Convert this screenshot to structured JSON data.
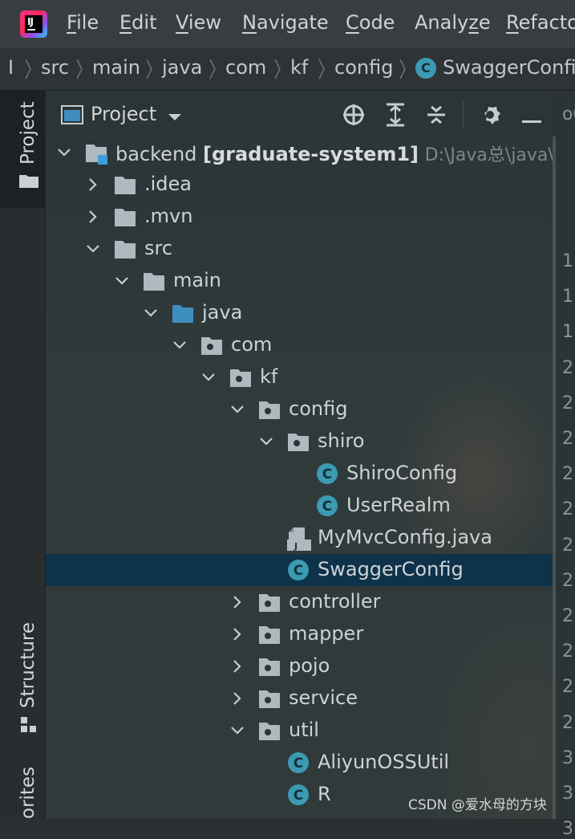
{
  "menu": {
    "items": [
      {
        "mnemonic": "F",
        "rest": "ile"
      },
      {
        "mnemonic": "E",
        "rest": "dit"
      },
      {
        "mnemonic": "V",
        "rest": "iew"
      },
      {
        "mnemonic": "N",
        "rest": "avigate"
      },
      {
        "mnemonic": "C",
        "rest": "ode"
      },
      {
        "prefix": "Analy",
        "mnemonic": "z",
        "rest": "e"
      },
      {
        "mnemonic": "R",
        "rest": "efacto"
      }
    ]
  },
  "breadcrumb": {
    "items": [
      "src",
      "main",
      "java",
      "com",
      "kf",
      "config"
    ],
    "current": "SwaggerConfig",
    "current_badge": "C"
  },
  "tool_strip": {
    "project_label": "Project",
    "structure_label": "Structure",
    "favorites_label": "orites"
  },
  "project_panel": {
    "title": "Project",
    "tree": [
      {
        "label": "backend",
        "bold": "[graduate-system1]",
        "path": "D:\\Java总\\java\\项",
        "depth": 0,
        "expanded": true,
        "icon": "module-folder-icon"
      },
      {
        "label": ".idea",
        "depth": 1,
        "expanded": false,
        "icon": "folder-icon"
      },
      {
        "label": ".mvn",
        "depth": 1,
        "expanded": false,
        "icon": "folder-icon"
      },
      {
        "label": "src",
        "depth": 1,
        "expanded": true,
        "icon": "folder-icon"
      },
      {
        "label": "main",
        "depth": 2,
        "expanded": true,
        "icon": "folder-icon"
      },
      {
        "label": "java",
        "depth": 3,
        "expanded": true,
        "icon": "source-folder-icon"
      },
      {
        "label": "com",
        "depth": 4,
        "expanded": true,
        "icon": "package-icon"
      },
      {
        "label": "kf",
        "depth": 5,
        "expanded": true,
        "icon": "package-icon"
      },
      {
        "label": "config",
        "depth": 6,
        "expanded": true,
        "icon": "package-icon"
      },
      {
        "label": "shiro",
        "depth": 7,
        "expanded": true,
        "icon": "package-icon"
      },
      {
        "label": "ShiroConfig",
        "depth": 8,
        "icon": "class-icon"
      },
      {
        "label": "UserRealm",
        "depth": 8,
        "icon": "class-icon"
      },
      {
        "label": "MyMvcConfig.java",
        "depth": 7,
        "icon": "java-file-icon"
      },
      {
        "label": "SwaggerConfig",
        "depth": 7,
        "icon": "class-icon",
        "selected": true
      },
      {
        "label": "controller",
        "depth": 6,
        "expanded": false,
        "icon": "package-icon"
      },
      {
        "label": "mapper",
        "depth": 6,
        "expanded": false,
        "icon": "package-icon"
      },
      {
        "label": "pojo",
        "depth": 6,
        "expanded": false,
        "icon": "package-icon"
      },
      {
        "label": "service",
        "depth": 6,
        "expanded": false,
        "icon": "package-icon"
      },
      {
        "label": "util",
        "depth": 6,
        "expanded": true,
        "icon": "package-icon"
      },
      {
        "label": "AliyunOSSUtil",
        "depth": 7,
        "icon": "class-icon"
      },
      {
        "label": "R",
        "depth": 7,
        "icon": "class-icon"
      }
    ]
  },
  "editor_gutter": {
    "tab_fragment": "oC",
    "line_numbers": [
      "1",
      "1",
      "1",
      "2",
      "2",
      "2",
      "2",
      "2",
      "2",
      "2",
      "2",
      "2",
      "2",
      "2",
      "3",
      "3",
      "3"
    ]
  },
  "watermark": "CSDN @爱水母的方块",
  "colors": {
    "selection": "#0e3249",
    "class_badge": "#3c9ab3",
    "source_folder": "#3d8ebd",
    "folder": "#aeb9c0"
  }
}
